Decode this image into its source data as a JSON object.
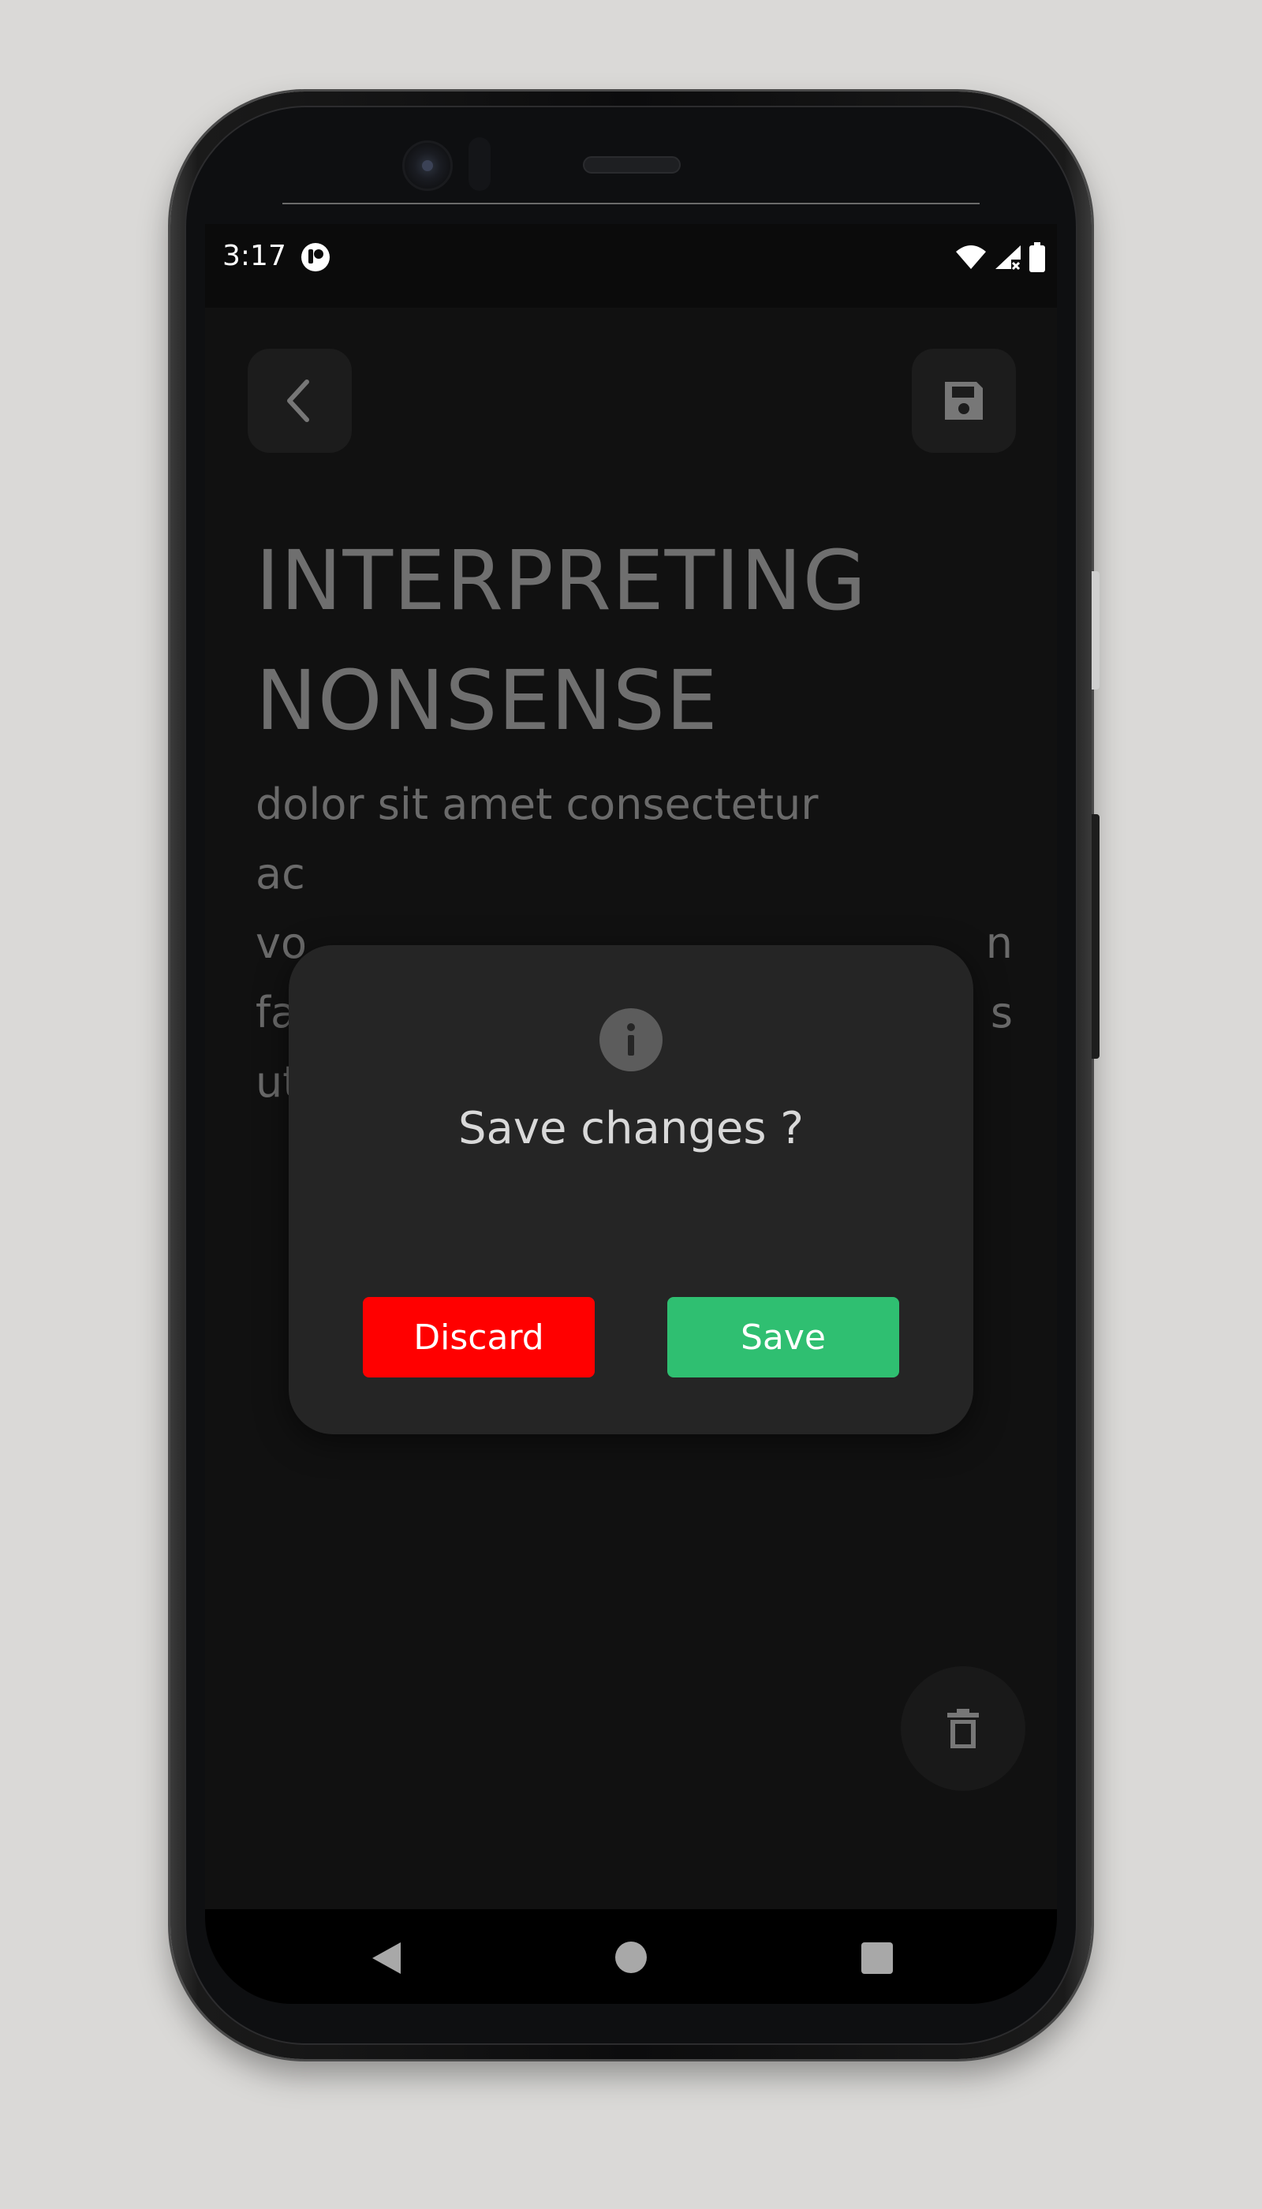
{
  "status_bar": {
    "time": "3:17",
    "app_icon": "indicator-app-icon",
    "icons": [
      "wifi-icon",
      "cell-signal-no-data-icon",
      "battery-full-icon"
    ]
  },
  "toolbar": {
    "back_icon": "chevron-left-icon",
    "save_icon": "floppy-disk-icon"
  },
  "note": {
    "title_line1": "INTERPRETING",
    "title_line2": "NONSENSE",
    "body_lines": [
      "dolor sit amet consectetur",
      "ac",
      "vo",
      "fa",
      "ut"
    ],
    "body_line_tails": [
      "",
      "",
      "n",
      "s",
      ""
    ]
  },
  "dialog": {
    "icon": "info-icon",
    "title": "Save changes ?",
    "discard_label": "Discard",
    "save_label": "Save",
    "colors": {
      "discard": "#ff0000",
      "save": "#2fbf71",
      "surface": "#252525"
    }
  },
  "fab": {
    "icon": "trash-icon"
  },
  "nav_bar": {
    "icons": [
      "nav-back-icon",
      "nav-home-icon",
      "nav-recents-icon"
    ]
  }
}
